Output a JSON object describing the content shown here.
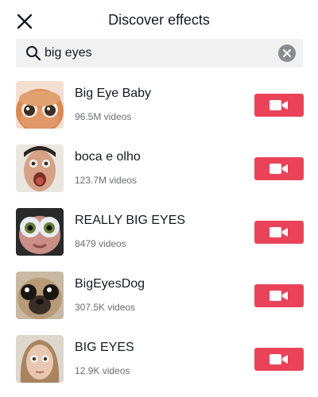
{
  "header": {
    "title": "Discover effects"
  },
  "search": {
    "value": "big eyes"
  },
  "effects": [
    {
      "name": "Big Eye Baby",
      "count": "96.5M videos"
    },
    {
      "name": "boca e olho",
      "count": "123.7M videos"
    },
    {
      "name": "REALLY BIG EYES",
      "count": "8479 videos"
    },
    {
      "name": "BigEyesDog",
      "count": "307.5K videos"
    },
    {
      "name": "BIG EYES",
      "count": "12.9K videos"
    }
  ],
  "icons": {
    "close": "close-icon",
    "search": "search-icon",
    "clear": "clear-icon",
    "record": "video-camera-icon"
  },
  "colors": {
    "accent": "#ea4359",
    "search_bg": "#f1f1f2",
    "muted_text": "#6b6c73"
  }
}
